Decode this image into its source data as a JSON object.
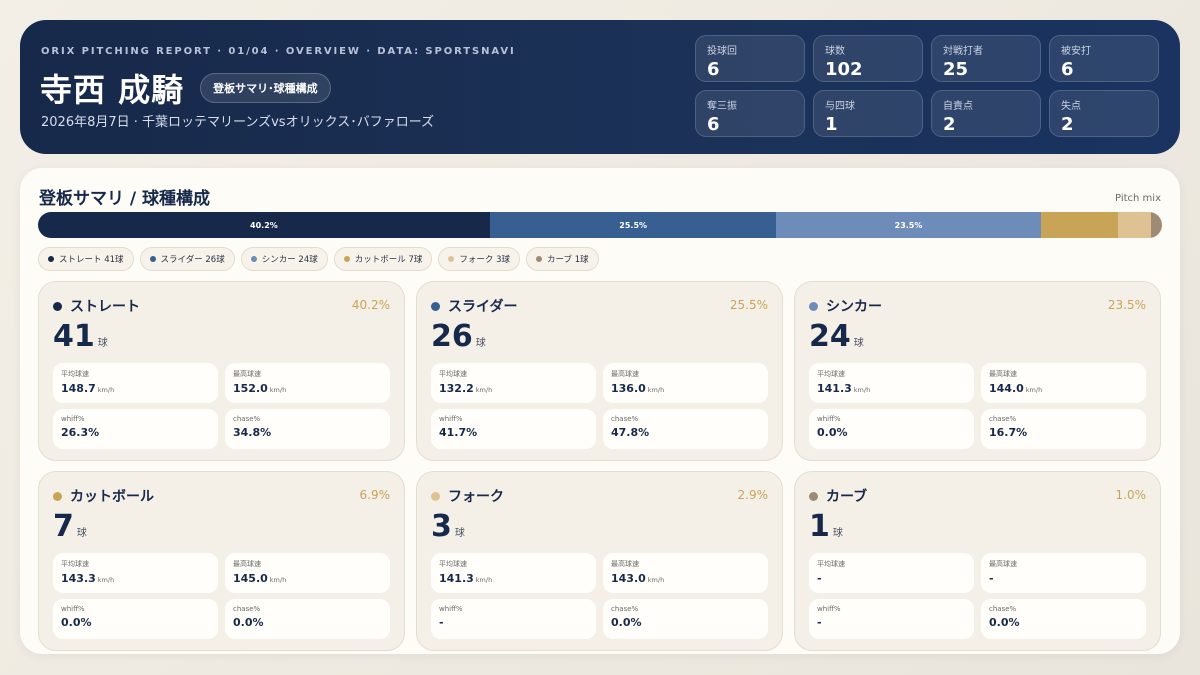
{
  "header": {
    "kicker": "ORIX PITCHING REPORT · 01/04 · OVERVIEW · DATA: SPORTSNAVI",
    "pitcher_name": "寺西 成騎",
    "tag": "登板サマリ･球種構成",
    "game_line": "2026年8月7日 · 千葉ロッテマリーンズvsオリックス･バファローズ",
    "stats": [
      {
        "label": "投球回",
        "value": "6"
      },
      {
        "label": "球数",
        "value": "102"
      },
      {
        "label": "対戦打者",
        "value": "25"
      },
      {
        "label": "被安打",
        "value": "6"
      },
      {
        "label": "奪三振",
        "value": "6"
      },
      {
        "label": "与四球",
        "value": "1"
      },
      {
        "label": "自責点",
        "value": "2"
      },
      {
        "label": "失点",
        "value": "2"
      }
    ]
  },
  "panel": {
    "title": "登板サマリ / 球種構成",
    "mix_label": "Pitch mix"
  },
  "colors": {
    "straight": "#17294a",
    "slider": "#375f91",
    "sinker": "#6d8cba",
    "cutter": "#c9a456",
    "fork": "#dec294",
    "curve": "#9f8b73"
  },
  "pitch_mix": [
    {
      "label": "40.2%",
      "percent": 40.2
    },
    {
      "label": "25.5%",
      "percent": 25.5
    },
    {
      "label": "23.5%",
      "percent": 23.5
    },
    {
      "label": "",
      "percent": 6.9
    },
    {
      "label": "",
      "percent": 2.9
    },
    {
      "label": "",
      "percent": 1.0
    }
  ],
  "chips": [
    {
      "label": "ストレート 41球"
    },
    {
      "label": "スライダー 26球"
    },
    {
      "label": "シンカー 24球"
    },
    {
      "label": "カットボール 7球"
    },
    {
      "label": "フォーク 3球"
    },
    {
      "label": "カーブ 1球"
    }
  ],
  "metric_labels": {
    "avg_speed": "平均球速",
    "max_speed": "最高球速",
    "whiff": "whiff%",
    "chase": "chase%",
    "speed_unit": "km/h",
    "count_unit": "球"
  },
  "cards": [
    {
      "name": "ストレート",
      "pct": "40.2%",
      "count": "41",
      "avg_speed": "148.7",
      "avg_unit": "km/h",
      "max_speed": "152.0",
      "max_unit": "km/h",
      "whiff": "26.3%",
      "chase": "34.8%"
    },
    {
      "name": "スライダー",
      "pct": "25.5%",
      "count": "26",
      "avg_speed": "132.2",
      "avg_unit": "km/h",
      "max_speed": "136.0",
      "max_unit": "km/h",
      "whiff": "41.7%",
      "chase": "47.8%"
    },
    {
      "name": "シンカー",
      "pct": "23.5%",
      "count": "24",
      "avg_speed": "141.3",
      "avg_unit": "km/h",
      "max_speed": "144.0",
      "max_unit": "km/h",
      "whiff": "0.0%",
      "chase": "16.7%"
    },
    {
      "name": "カットボール",
      "pct": "6.9%",
      "count": "7",
      "avg_speed": "143.3",
      "avg_unit": "km/h",
      "max_speed": "145.0",
      "max_unit": "km/h",
      "whiff": "0.0%",
      "chase": "0.0%"
    },
    {
      "name": "フォーク",
      "pct": "2.9%",
      "count": "3",
      "avg_speed": "141.3",
      "avg_unit": "km/h",
      "max_speed": "143.0",
      "max_unit": "km/h",
      "whiff": "-",
      "chase": "0.0%"
    },
    {
      "name": "カーブ",
      "pct": "1.0%",
      "count": "1",
      "avg_speed": "-",
      "avg_unit": "",
      "max_speed": "-",
      "max_unit": "",
      "whiff": "-",
      "chase": "0.0%"
    }
  ]
}
